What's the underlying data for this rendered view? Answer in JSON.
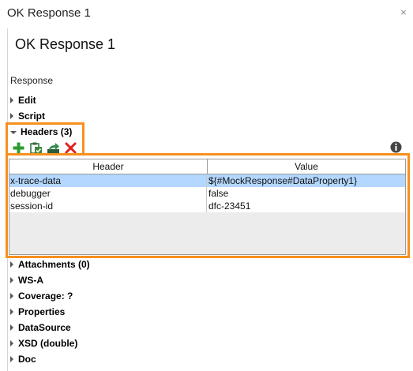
{
  "window": {
    "title": "OK Response 1",
    "close_glyph": "×"
  },
  "page": {
    "title": "OK Response 1"
  },
  "response_label": "Response",
  "sections_top": [
    {
      "label": "Edit",
      "expanded": false
    },
    {
      "label": "Script",
      "expanded": false
    }
  ],
  "headers": {
    "label": "Headers (3)",
    "expanded": true,
    "toolbar": [
      {
        "icon": "add-icon",
        "color": "#2e9b2e"
      },
      {
        "icon": "paste-icon",
        "color": "#3a8a3a"
      },
      {
        "icon": "export-icon",
        "color": "#2e7d4a"
      },
      {
        "icon": "delete-icon",
        "color": "#e02020"
      }
    ],
    "info_icon": "info-icon",
    "columns": [
      "Header",
      "Value"
    ],
    "rows": [
      {
        "header": "x-trace-data",
        "value": "${#MockResponse#DataProperty1}",
        "selected": true
      },
      {
        "header": "debugger",
        "value": "false",
        "selected": false
      },
      {
        "header": "session-id",
        "value": "dfc-23451",
        "selected": false
      }
    ]
  },
  "sections_bottom": [
    {
      "label": "Attachments (0)"
    },
    {
      "label": "WS-A"
    },
    {
      "label": "Coverage: ?"
    },
    {
      "label": "Properties"
    },
    {
      "label": "DataSource"
    },
    {
      "label": "XSD (double)"
    },
    {
      "label": "Doc"
    }
  ],
  "colors": {
    "highlight": "#f7901e",
    "selection": "#b3d7ff"
  }
}
